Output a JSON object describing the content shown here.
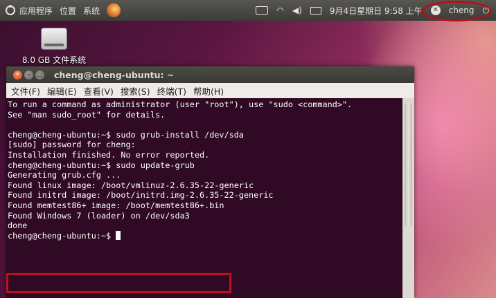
{
  "panel": {
    "menus": [
      "应用程序",
      "位置",
      "系统"
    ],
    "datetime": "9月4日星期日 9:58 上午",
    "user": "cheng"
  },
  "desktop": {
    "drive_label": "8.0 GB 文件系统"
  },
  "window": {
    "title": "cheng@cheng-ubuntu: ~",
    "menus": [
      "文件(F)",
      "编辑(E)",
      "查看(V)",
      "搜索(S)",
      "终端(T)",
      "帮助(H)"
    ]
  },
  "terminal": {
    "lines": [
      "To run a command as administrator (user \"root\"), use \"sudo <command>\".",
      "See \"man sudo_root\" for details.",
      "",
      "cheng@cheng-ubuntu:~$ sudo grub-install /dev/sda",
      "[sudo] password for cheng:",
      "Installation finished. No error reported.",
      "cheng@cheng-ubuntu:~$ sudo update-grub",
      "Generating grub.cfg ...",
      "Found linux image: /boot/vmlinuz-2.6.35-22-generic",
      "Found initrd image: /boot/initrd.img-2.6.35-22-generic",
      "Found memtest86+ image: /boot/memtest86+.bin",
      "Found Windows 7 (loader) on /dev/sda3",
      "done"
    ],
    "prompt": "cheng@cheng-ubuntu:~$ "
  }
}
